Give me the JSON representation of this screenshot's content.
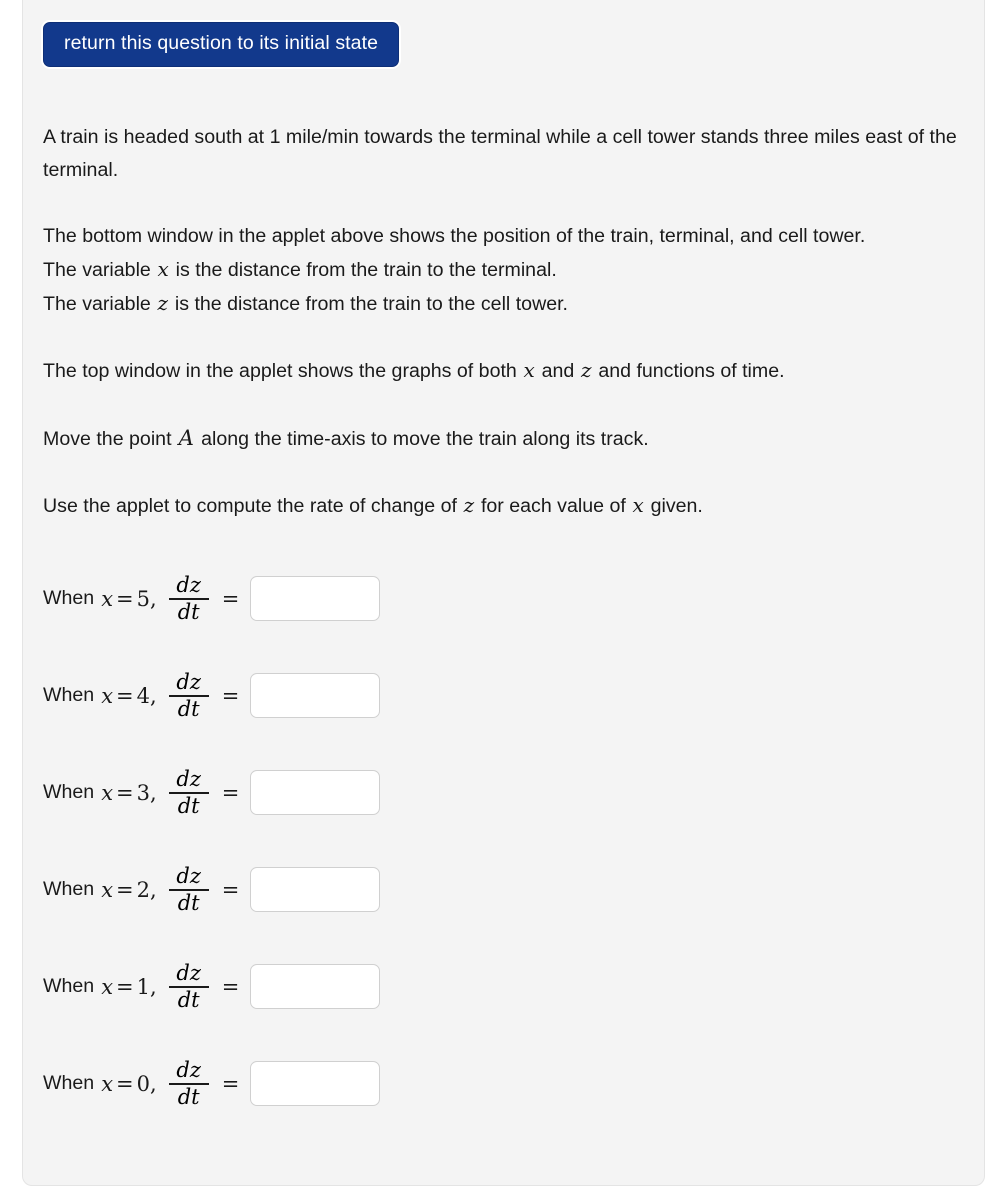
{
  "card": {
    "background_color": "#f4f4f4",
    "border_color": "#e4e4e4"
  },
  "reset_button": {
    "label": "return this question to its initial state",
    "background_color": "#12398c",
    "text_color": "#ffffff"
  },
  "prose": {
    "p1": {
      "text": "A train is headed south at 1 mile/min towards the terminal while a cell tower stands three miles east of the terminal."
    },
    "p2": {
      "text": "The bottom window in the applet above shows the position of the train, terminal, and cell tower."
    },
    "p3": {
      "before": "The variable",
      "var": "x",
      "after": "is the distance from the train to the terminal."
    },
    "p4": {
      "before": "The variable",
      "var": "z",
      "after": "is the distance from the train to the cell tower."
    },
    "p5": {
      "before": "The top window in the applet shows the graphs of both",
      "var1": "x",
      "middle": "and",
      "var2": "z",
      "after": "and functions of time."
    },
    "p6": {
      "before": "Move the point",
      "var": "A",
      "after": "along the time-axis to move the train along its track."
    },
    "p7": {
      "before": "Use the applet to compute the rate of change of",
      "var1": "z",
      "middle": "for each value of",
      "var2": "x",
      "after": "given."
    }
  },
  "answers": {
    "label_prefix": "When",
    "variable": "x",
    "equals": "=",
    "fraction_numerator": "dz",
    "fraction_denominator": "dt",
    "result_equals": "=",
    "rows": [
      {
        "x_value": "5,",
        "input_value": "",
        "placeholder": ""
      },
      {
        "x_value": "4,",
        "input_value": "",
        "placeholder": ""
      },
      {
        "x_value": "3,",
        "input_value": "",
        "placeholder": ""
      },
      {
        "x_value": "2,",
        "input_value": "",
        "placeholder": ""
      },
      {
        "x_value": "1,",
        "input_value": "",
        "placeholder": ""
      },
      {
        "x_value": "0,",
        "input_value": "",
        "placeholder": ""
      }
    ]
  }
}
